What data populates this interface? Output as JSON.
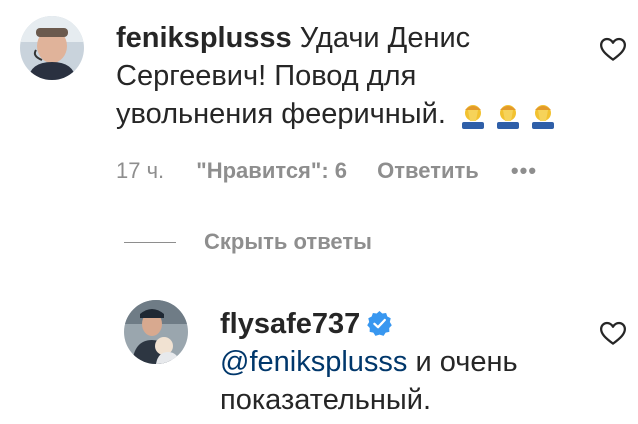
{
  "comments": [
    {
      "username": "feniksplusss",
      "text_line1": "Удачи Денис",
      "text_line2": "Сергеевич! Повод для",
      "text_line3": "увольнения фееричный.",
      "emoji_name": "face-palm-emoji",
      "emoji_count": 3,
      "time": "17 ч.",
      "likes": "\"Нравится\": 6",
      "reply": "Ответить",
      "more": "•••"
    }
  ],
  "hide_replies": "Скрыть ответы",
  "reply_comment": {
    "username": "flysafe737",
    "verified_icon": "verified-badge-icon",
    "mention": "@feniksplusss",
    "text_line1_rest": " и очень",
    "text_line2": "показательный."
  },
  "colors": {
    "text": "#262626",
    "secondary": "#8e8e8e",
    "mention": "#00376b",
    "verified": "#3897f0"
  }
}
